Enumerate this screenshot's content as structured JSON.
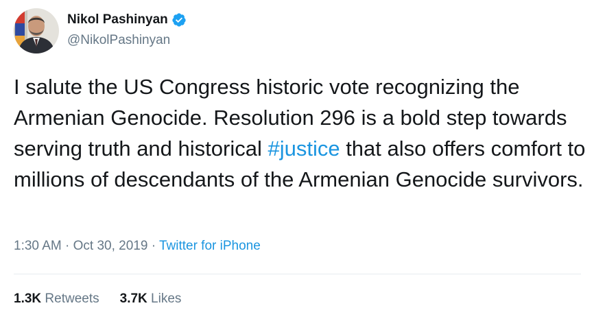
{
  "author": {
    "name": "Nikol Pashinyan",
    "handle": "@NikolPashinyan",
    "verified": true,
    "avatar_icon": "profile-photo"
  },
  "tweet": {
    "text_before_hashtag": "I salute the US Congress historic vote recognizing the Armenian Genocide. Resolution 296 is a bold step towards serving truth and historical ",
    "hashtag": "#justice",
    "text_after_hashtag": " that also offers comfort to millions of descendants of the Armenian Genocide survivors."
  },
  "meta": {
    "time": "1:30 AM",
    "separator": "·",
    "date": "Oct 30, 2019",
    "source": "Twitter for iPhone"
  },
  "stats": {
    "retweets_count": "1.3K",
    "retweets_label": "Retweets",
    "likes_count": "3.7K",
    "likes_label": "Likes"
  },
  "colors": {
    "text": "#14171a",
    "secondary": "#657786",
    "link": "#1b95e0",
    "divider": "#e6ecf0",
    "verified_badge": "#1da1f2"
  }
}
